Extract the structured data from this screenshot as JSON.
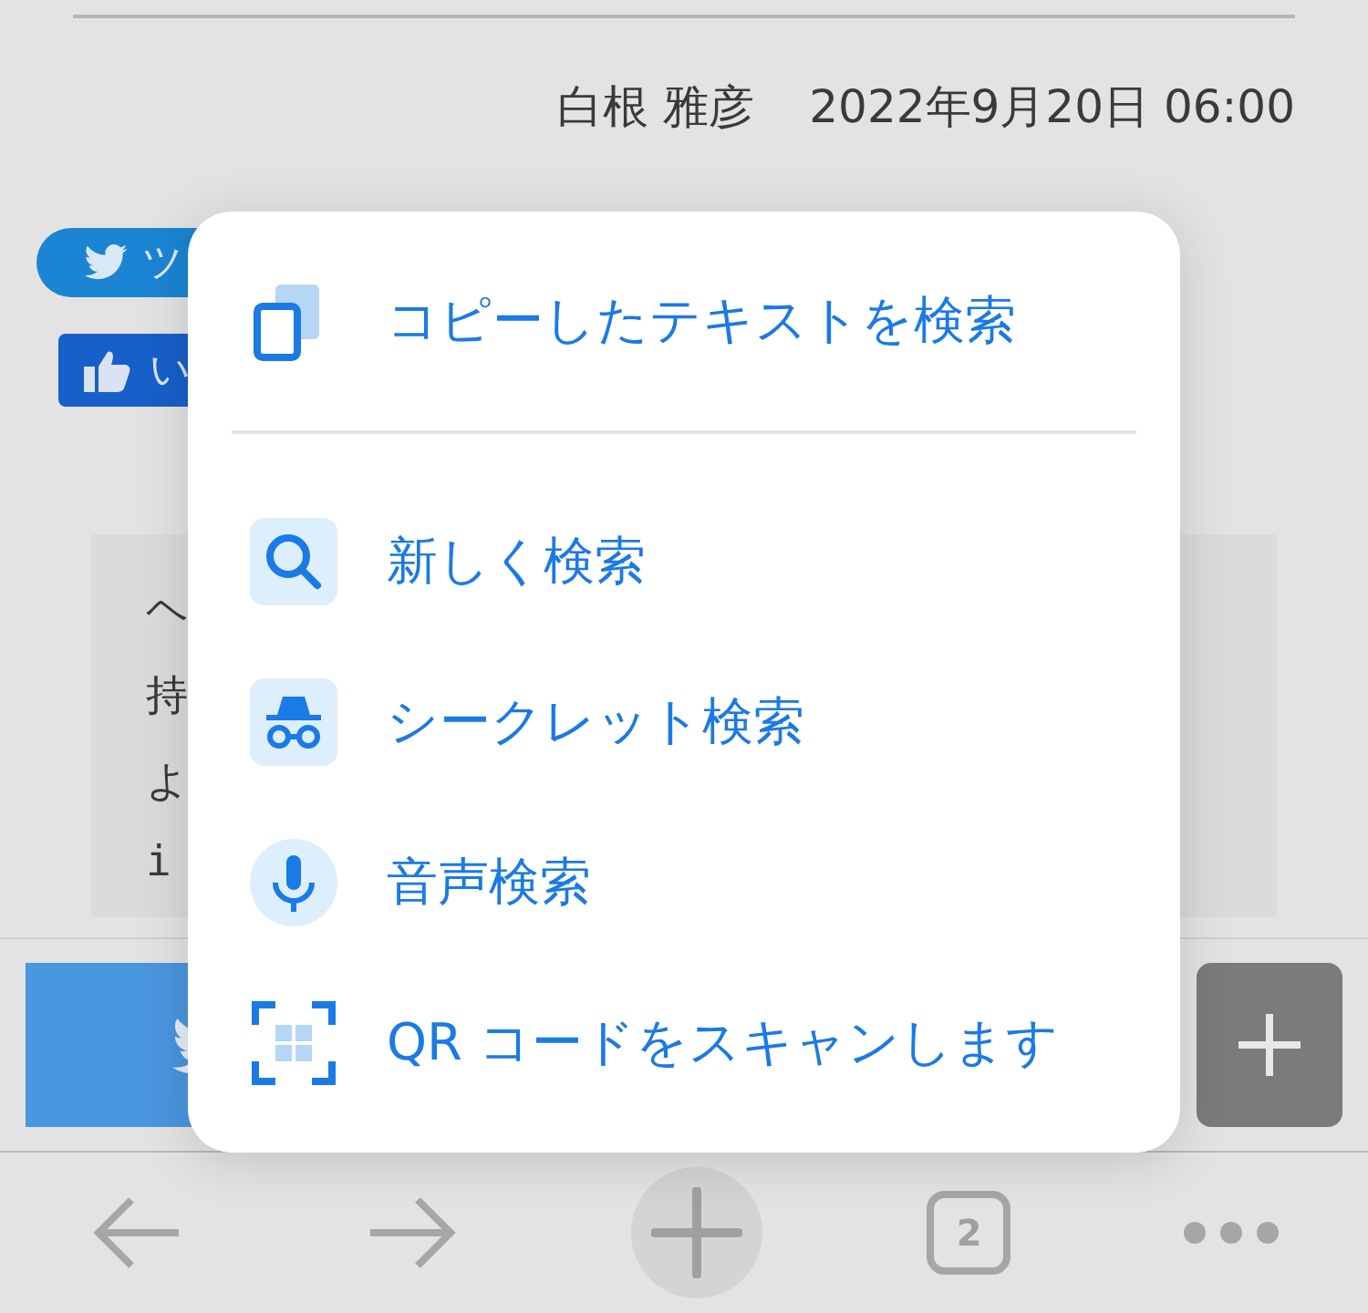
{
  "article": {
    "author": "白根 雅彦",
    "date": "2022年9月20日 06:00",
    "tweet_button": "ツ",
    "like_button": "い",
    "code_lines": [
      {
        "left": "ヘ"
      },
      {
        "left": "持"
      },
      {
        "left": "よ"
      },
      {
        "left": "i"
      }
    ]
  },
  "menu": {
    "items": [
      {
        "kind": "copy",
        "label": "コピーしたテキストを検索"
      },
      {
        "kind": "search",
        "label": "新しく検索"
      },
      {
        "kind": "incognito",
        "label": "シークレット検索"
      },
      {
        "kind": "voice",
        "label": "音声検索"
      },
      {
        "kind": "qr",
        "label": "QR コードをスキャンします"
      }
    ]
  },
  "toolbar": {
    "tab_count": "2"
  }
}
